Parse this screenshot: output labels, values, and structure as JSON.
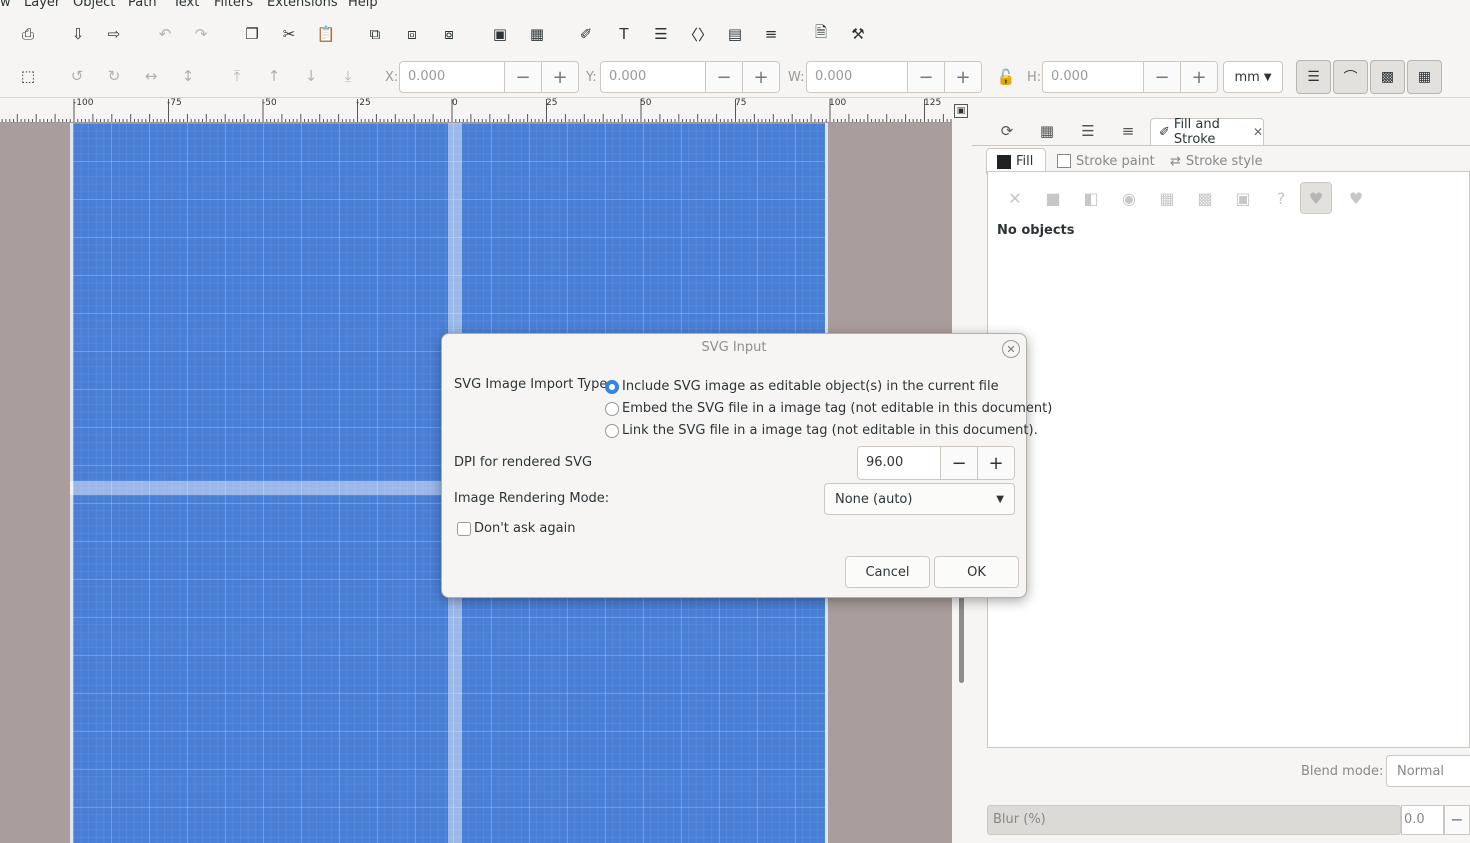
{
  "menu": [
    "w",
    "Layer",
    "Object",
    "Path",
    "Text",
    "Filters",
    "Extensions",
    "Help"
  ],
  "toolbar": {
    "icons": [
      "print-icon",
      "import-icon",
      "export-icon",
      "undo-icon",
      "redo-icon",
      "copy-icon",
      "cut-icon",
      "paste-icon",
      "duplicate-icon",
      "clone-icon",
      "unlink-clone-icon",
      "group-icon",
      "ungroup-icon",
      "xml-editor-icon",
      "text-font-icon",
      "layers-icon",
      "objects-icon",
      "symbols-icon",
      "align-icon",
      "document-properties-icon",
      "preferences-icon"
    ]
  },
  "controls": {
    "x_label": "X:",
    "x_value": "0.000",
    "y_label": "Y:",
    "y_value": "0.000",
    "w_label": "W:",
    "w_value": "0.000",
    "h_label": "H:",
    "h_value": "0.000",
    "unit": "mm",
    "minus": "−",
    "plus": "+"
  },
  "ruler": {
    "labels": [
      "-100",
      "-75",
      "-50",
      "-25",
      "0",
      "25",
      "50",
      "75",
      "100",
      "125"
    ]
  },
  "panel": {
    "tab_title": "Fill and Stroke",
    "fill_tab": "Fill",
    "stroke_paint_tab": "Stroke paint",
    "stroke_style_tab": "Stroke style",
    "status": "No objects",
    "blend_label": "Blend mode:",
    "blend_value": "Normal",
    "blur_label": "Blur (%)",
    "blur_value": "0.0"
  },
  "dialog": {
    "title": "SVG Input",
    "import_type_label": "SVG Image Import Type:",
    "option_include": "Include SVG image as editable object(s) in the current file",
    "option_embed": "Embed the SVG file in a image tag (not editable in this document)",
    "option_link": "Link the SVG file in a image tag (not editable in this document).",
    "dpi_label": "DPI for rendered SVG",
    "dpi_value": "96.00",
    "render_mode_label": "Image Rendering Mode:",
    "render_mode_value": "None (auto)",
    "dont_ask": "Don't ask again",
    "cancel": "Cancel",
    "ok": "OK"
  },
  "colors": {
    "page": "#4a7fd6",
    "desk": "#aa9e9c",
    "accent": "#3584e4"
  }
}
